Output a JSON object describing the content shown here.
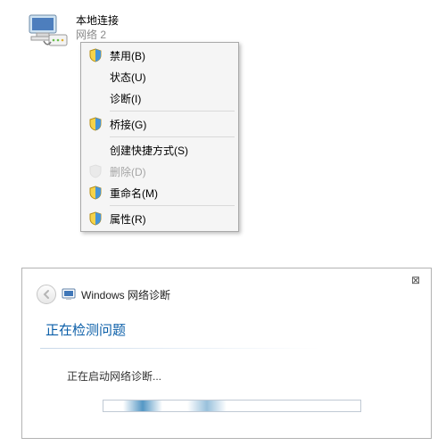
{
  "adapter": {
    "title": "本地连接",
    "subtitle": "网络 2"
  },
  "menu": {
    "disable": "禁用(B)",
    "status": "状态(U)",
    "diagnose": "诊断(I)",
    "bridge": "桥接(G)",
    "shortcut": "创建快捷方式(S)",
    "delete": "删除(D)",
    "rename": "重命名(M)",
    "properties": "属性(R)"
  },
  "dialog": {
    "app_title": "Windows 网络诊断",
    "heading": "正在检测问题",
    "status": "正在启动网络诊断...",
    "close_glyph": "⊠"
  }
}
